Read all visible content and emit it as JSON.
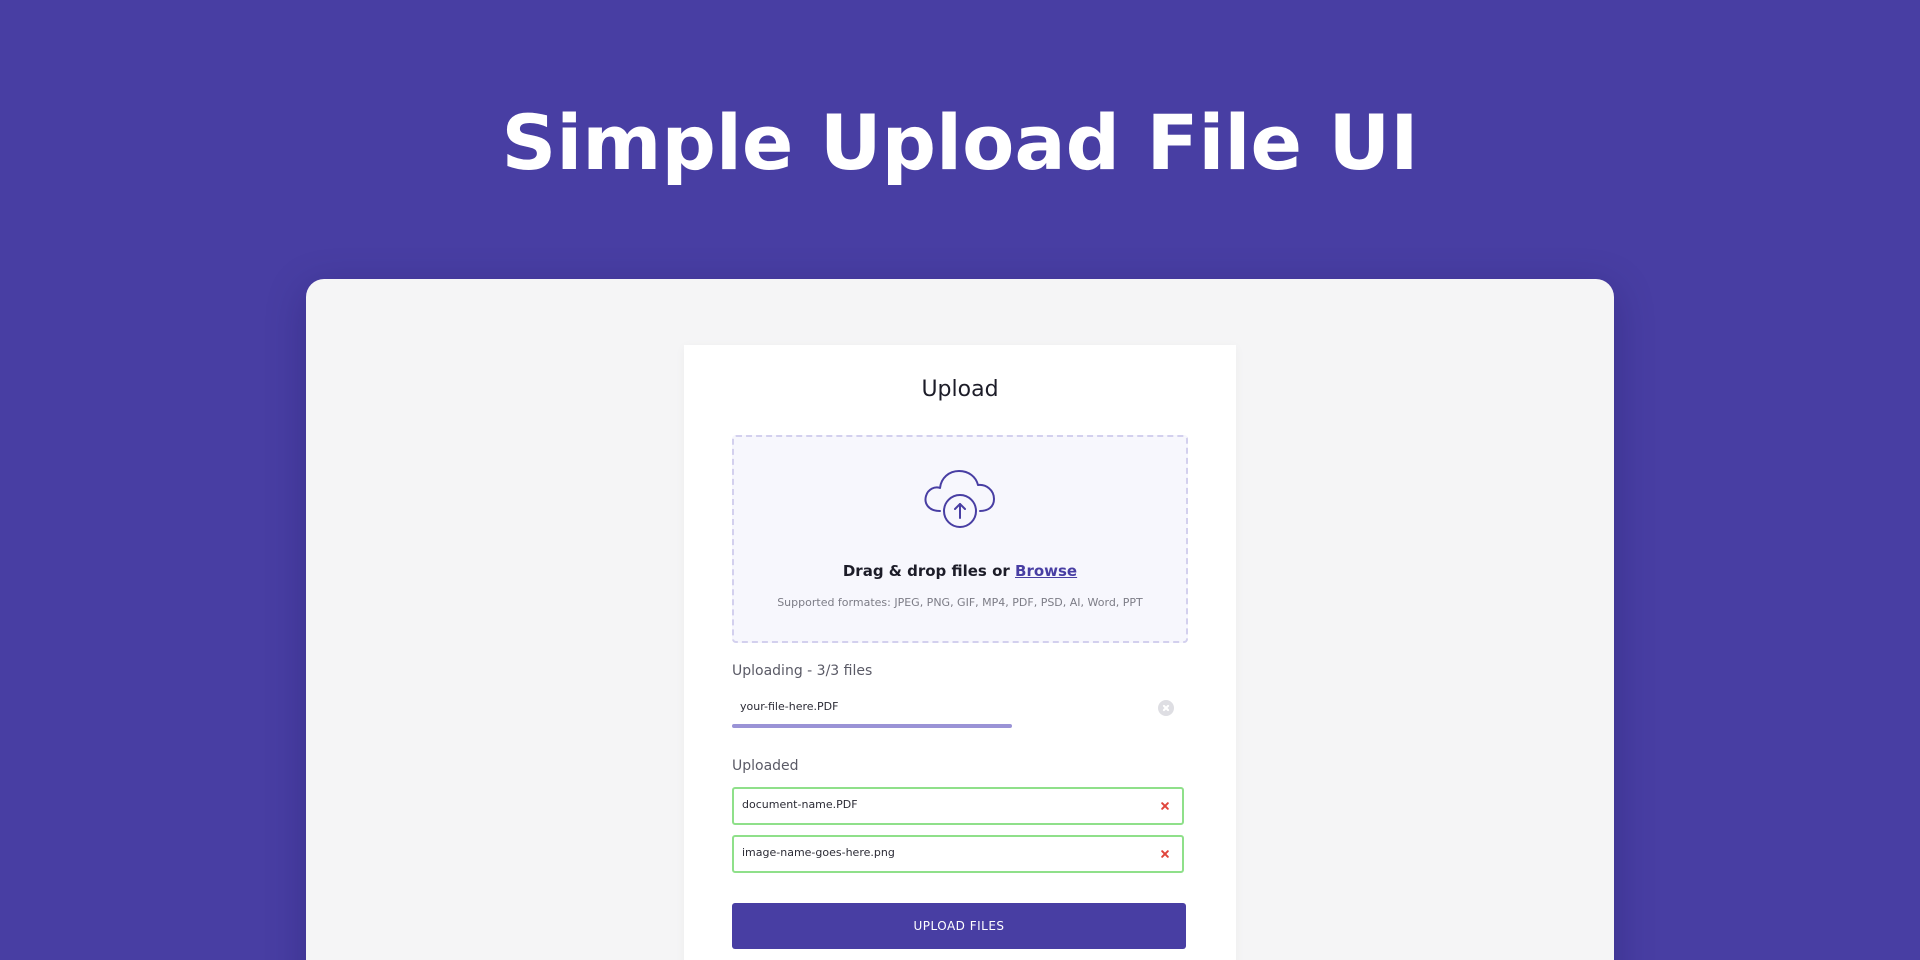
{
  "page": {
    "title": "Simple Upload File UI"
  },
  "upload_card": {
    "title": "Upload",
    "dropzone": {
      "prompt_prefix": "Drag & drop files or ",
      "browse_label": "Browse",
      "formats": "Supported formates: JPEG, PNG, GIF, MP4, PDF, PSD, AI, Word, PPT",
      "icon": "cloud-upload-icon"
    },
    "uploading": {
      "label": "Uploading - 3/3 files",
      "file_name": "your-file-here.PDF",
      "progress": 0.62,
      "clear_icon": "clear-icon"
    },
    "uploaded": {
      "label": "Uploaded",
      "files": [
        {
          "name": "document-name.PDF"
        },
        {
          "name": "image-name-goes-here.png"
        }
      ],
      "remove_icon": "remove-icon"
    },
    "submit_label": "UPLOAD FILES"
  },
  "colors": {
    "background": "#483ea3",
    "accent": "#483ea3",
    "progress": "#9a93d6",
    "success_border": "#8fe08a",
    "danger": "#e0453c"
  }
}
